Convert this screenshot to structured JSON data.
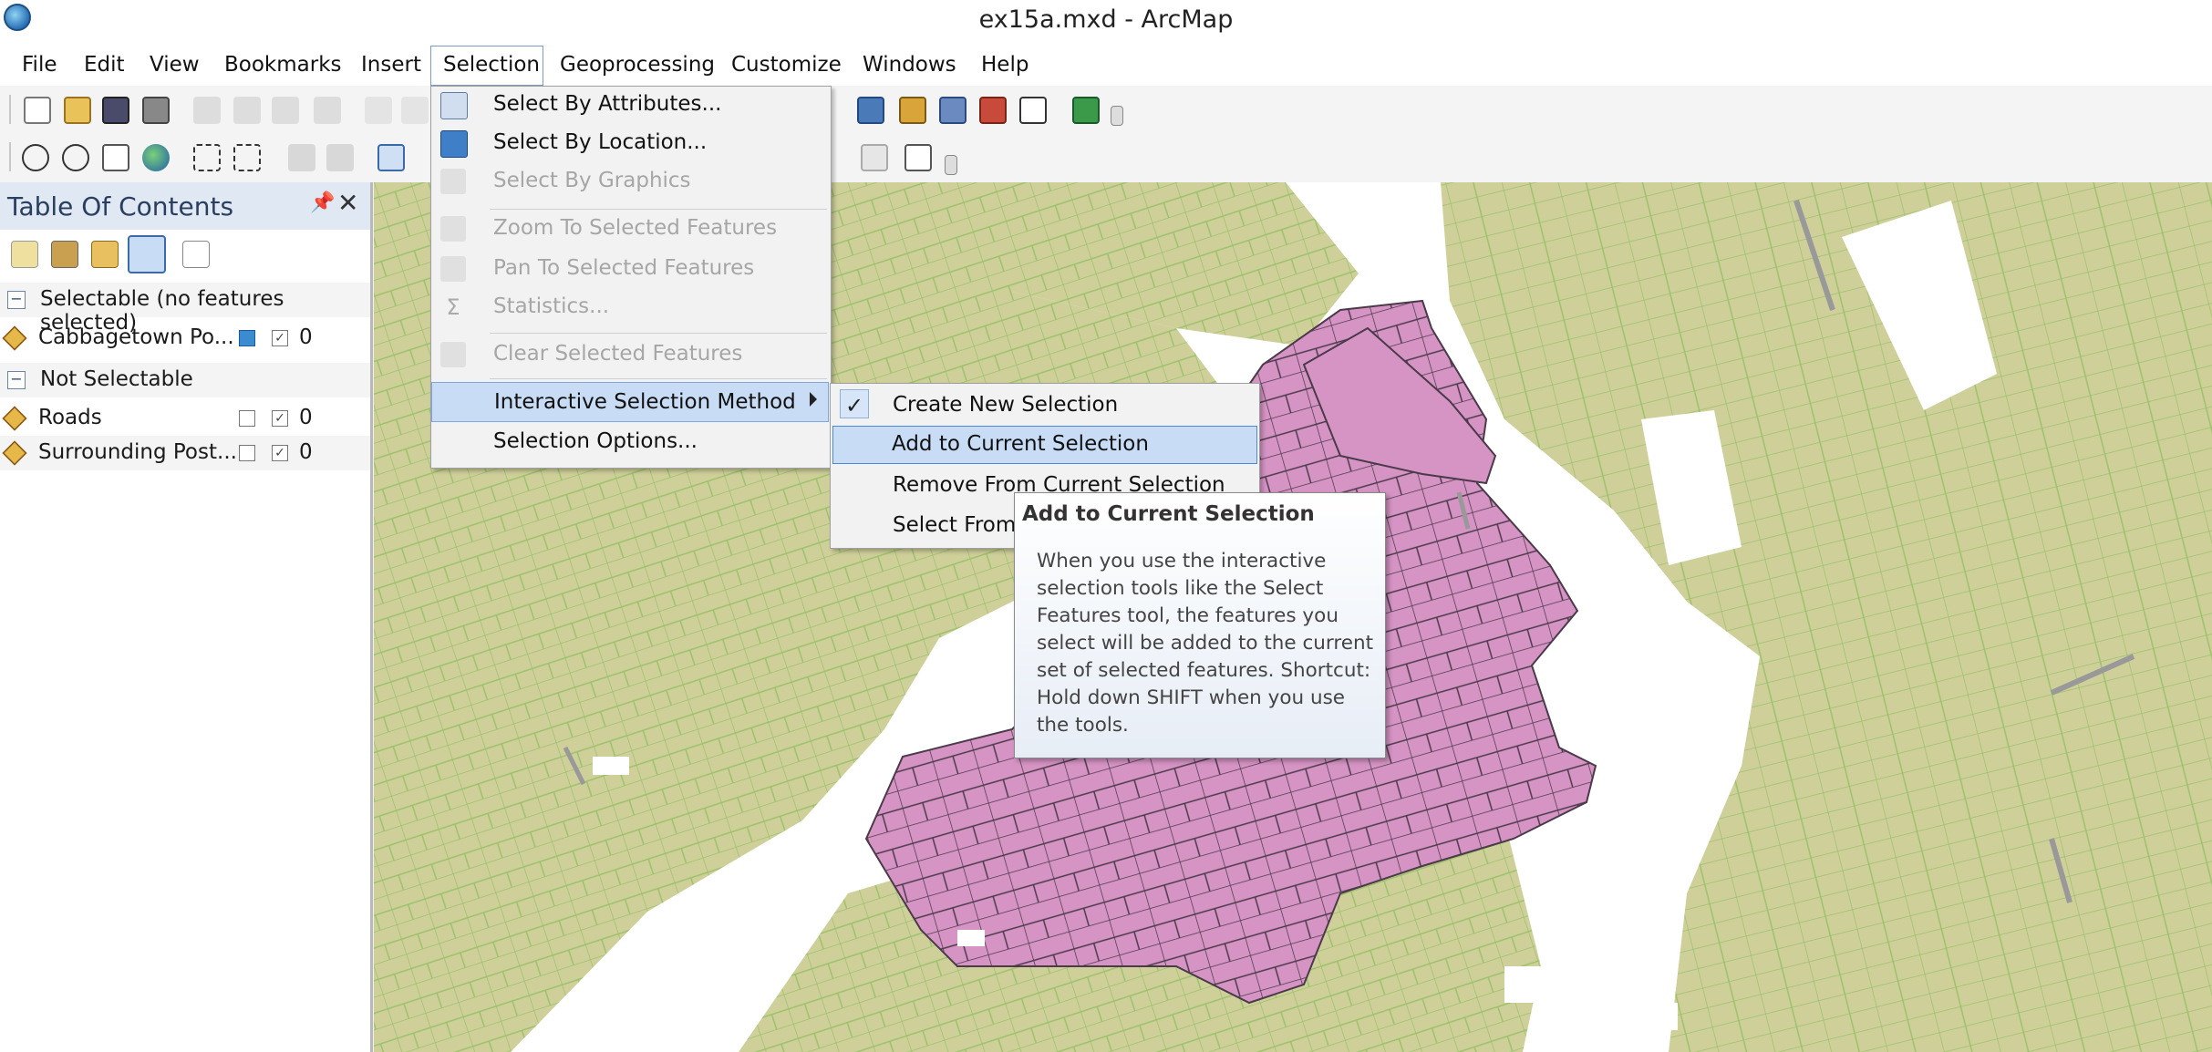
{
  "window": {
    "title": "ex15a.mxd - ArcMap"
  },
  "menubar": {
    "items": [
      "File",
      "Edit",
      "View",
      "Bookmarks",
      "Insert",
      "Selection",
      "Geoprocessing",
      "Customize",
      "Windows",
      "Help"
    ],
    "open_menu": "Selection"
  },
  "toc": {
    "title": "Table Of Contents",
    "groups": [
      {
        "label": "Selectable (no features selected)",
        "layers": [
          {
            "name": "Cabbagetown Po...",
            "count": "0"
          }
        ]
      },
      {
        "label": "Not Selectable",
        "layers": [
          {
            "name": "Roads",
            "count": "0"
          },
          {
            "name": "Surrounding Post...",
            "count": "0"
          }
        ]
      }
    ]
  },
  "selection_menu": {
    "items": [
      {
        "label": "Select By Attributes...",
        "enabled": true,
        "icon": "select-by-attributes-icon"
      },
      {
        "label": "Select By Location...",
        "enabled": true,
        "icon": "select-by-location-icon"
      },
      {
        "label": "Select By Graphics",
        "enabled": false,
        "icon": "select-by-graphics-icon"
      },
      {
        "label": "Zoom To Selected Features",
        "enabled": false,
        "icon": "zoom-to-selected-icon"
      },
      {
        "label": "Pan To Selected Features",
        "enabled": false,
        "icon": "pan-to-selected-icon"
      },
      {
        "label": "Statistics...",
        "enabled": false,
        "icon": "statistics-icon"
      },
      {
        "label": "Clear Selected Features",
        "enabled": false,
        "icon": "clear-selection-icon"
      },
      {
        "label": "Interactive Selection Method",
        "enabled": true,
        "highlighted": true,
        "has_submenu": true
      },
      {
        "label": "Selection Options...",
        "enabled": true
      }
    ]
  },
  "interactive_submenu": {
    "items": [
      {
        "label": "Create New Selection",
        "checked": true
      },
      {
        "label": "Add to Current Selection",
        "highlighted": true
      },
      {
        "label": "Remove From Current Selection"
      },
      {
        "label": "Select From Current Selection"
      }
    ]
  },
  "tooltip": {
    "title": "Add to Current Selection",
    "body": "When you use the interactive selection tools like the Select Features tool, the features you select will be added to the current set of selected features. Shortcut: Hold down SHIFT when you use the tools."
  },
  "colors": {
    "parcel_fill": "#cfcf9a",
    "parcel_stroke": "#9cc26b",
    "selected_fill": "#d694c4",
    "selected_stroke": "#4a3a4a",
    "menu_highlight": "#c8dcf6"
  }
}
